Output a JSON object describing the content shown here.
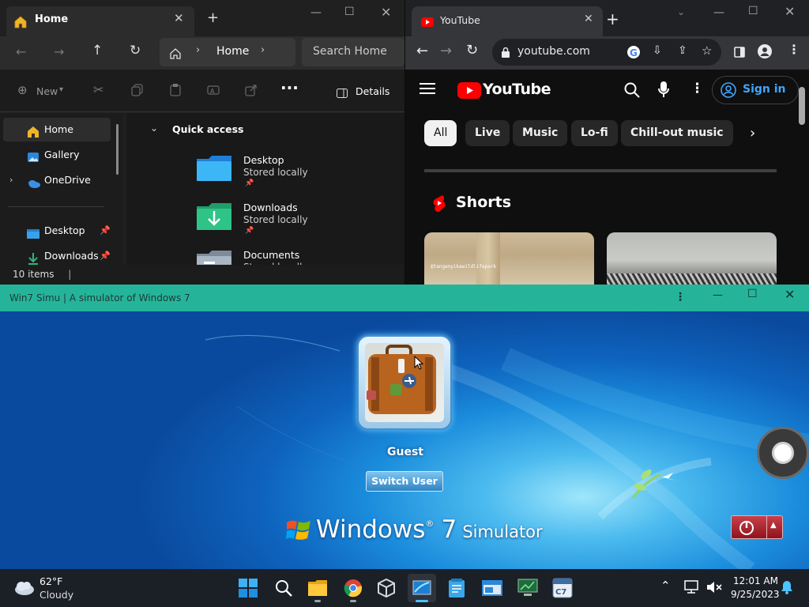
{
  "explorer": {
    "tab_title": "Home",
    "address_crumb": "Home",
    "search_placeholder": "Search Home",
    "toolbar": {
      "new_label": "New",
      "details_label": "Details"
    },
    "sidebar": [
      {
        "label": "Home",
        "icon": "home-icon",
        "active": true
      },
      {
        "label": "Gallery",
        "icon": "gallery-icon"
      },
      {
        "label": "OneDrive",
        "icon": "onedrive-icon",
        "expandable": true
      },
      {
        "label": "Desktop",
        "icon": "desktop-folder-icon",
        "pinned": true
      },
      {
        "label": "Downloads",
        "icon": "downloads-folder-icon",
        "pinned": true
      }
    ],
    "section_title": "Quick access",
    "quick_access": [
      {
        "name": "Desktop",
        "subtitle": "Stored locally"
      },
      {
        "name": "Downloads",
        "subtitle": "Stored locally"
      },
      {
        "name": "Documents",
        "subtitle": "Stored locally"
      }
    ],
    "status": "10 items",
    "accent": "#f0b429"
  },
  "chrome": {
    "tab_title": "YouTube",
    "url": "youtube.com"
  },
  "youtube": {
    "logo_text": "YouTube",
    "sign_in": "Sign in",
    "chips": [
      "All",
      "Live",
      "Music",
      "Lo-fi",
      "Chill-out music"
    ],
    "shorts_title": "Shorts",
    "short_overlay": "@tanganyikawildlifepark",
    "brand_red": "#ff0000",
    "link_blue": "#3ea6ff"
  },
  "simulator": {
    "window_title": "Win7 Simu | A simulator of Windows 7",
    "user_name": "Guest",
    "switch_user": "Switch User",
    "logo_main": "Windows",
    "logo_version": "7",
    "logo_suffix": "Simulator",
    "reg_mark": "®",
    "title_bar_color": "#25b49a"
  },
  "taskbar": {
    "weather_temp": "62°F",
    "weather_cond": "Cloudy",
    "time": "12:01 AM",
    "date": "9/25/2023"
  }
}
